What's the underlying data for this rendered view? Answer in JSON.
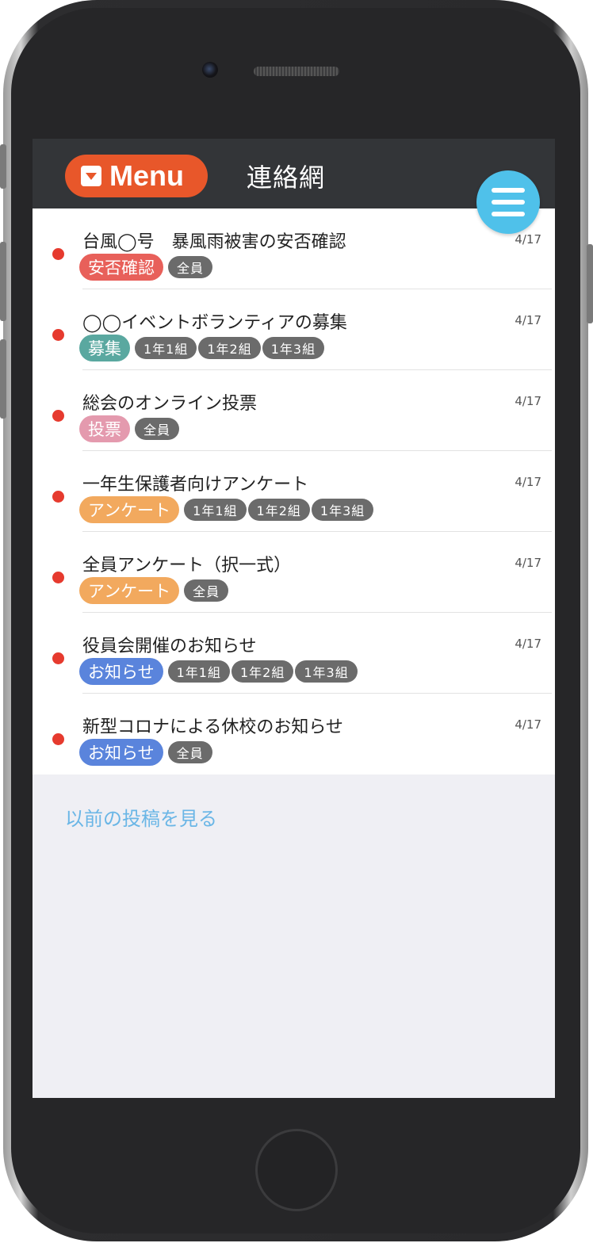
{
  "header": {
    "menu_label": "Menu",
    "title": "連絡網"
  },
  "posts": [
    {
      "title": "台風◯号　暴風雨被害の安否確認",
      "date": "4/17",
      "category": "安否確認",
      "category_color": "#e8605a",
      "audiences": [
        "全員"
      ],
      "unread": true
    },
    {
      "title": "◯◯イベントボランティアの募集",
      "date": "4/17",
      "category": "募集",
      "category_color": "#5aa8a0",
      "audiences": [
        "1年1組",
        "1年2組",
        "1年3組"
      ],
      "unread": true
    },
    {
      "title": "総会のオンライン投票",
      "date": "4/17",
      "category": "投票",
      "category_color": "#e49aae",
      "audiences": [
        "全員"
      ],
      "unread": true
    },
    {
      "title": "一年生保護者向けアンケート",
      "date": "4/17",
      "category": "アンケート",
      "category_color": "#f2a95e",
      "audiences": [
        "1年1組",
        "1年2組",
        "1年3組"
      ],
      "unread": true
    },
    {
      "title": "全員アンケート（択一式）",
      "date": "4/17",
      "category": "アンケート",
      "category_color": "#f2a95e",
      "audiences": [
        "全員"
      ],
      "unread": true
    },
    {
      "title": "役員会開催のお知らせ",
      "date": "4/17",
      "category": "お知らせ",
      "category_color": "#5a84dc",
      "audiences": [
        "1年1組",
        "1年2組",
        "1年3組"
      ],
      "unread": true
    },
    {
      "title": "新型コロナによる休校のお知らせ",
      "date": "4/17",
      "category": "お知らせ",
      "category_color": "#5a84dc",
      "audiences": [
        "全員"
      ],
      "unread": true
    }
  ],
  "more_link": "以前の投稿を見る",
  "colors": {
    "menu_button": "#e8572a",
    "header_bg": "#333538",
    "fab": "#4fc1ea",
    "unread_dot": "#e63a2e",
    "link": "#6ab6e6"
  }
}
